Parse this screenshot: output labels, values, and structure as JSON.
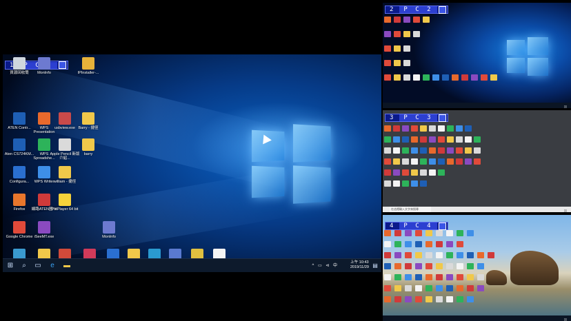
{
  "main": {
    "badge": {
      "number": "1",
      "label": "P C  1"
    },
    "icons": [
      {
        "label": "資源回收筒",
        "color": "#cfd6de"
      },
      {
        "label": "MonInfo",
        "color": "#6d7ad0"
      },
      {
        "label": "IPInstaller-...",
        "color": "#e6b23a"
      },
      {
        "label": "ATEN Contr...",
        "color": "#1e5fb5"
      },
      {
        "label": "WPS Presentation",
        "color": "#e8692c"
      },
      {
        "label": "usbview.exe",
        "color": "#c94a4a"
      },
      {
        "label": "Barry - 捷徑",
        "color": "#f0c84a"
      },
      {
        "label": "Aten CS724KM...",
        "color": "#1e5fb5"
      },
      {
        "label": "WPS Spreadshe...",
        "color": "#2db35a"
      },
      {
        "label": "Apple Pencil 新版介紹...",
        "color": "#dadada"
      },
      {
        "label": "barry",
        "color": "#f0c84a"
      },
      {
        "label": "Configura...",
        "color": "#2a6fd0"
      },
      {
        "label": "WPS Writer",
        "color": "#3e8fe8"
      },
      {
        "label": "william - 捷徑",
        "color": "#f0c84a"
      },
      {
        "label": "Firefox",
        "color": "#e8762c"
      },
      {
        "label": "線路ATEN圖 fit",
        "color": "#d03a3a"
      },
      {
        "label": "PotPlayer 64 bit",
        "color": "#f5d23a"
      },
      {
        "label": "Google Chrome",
        "color": "#e04a3a"
      },
      {
        "label": "iSeeMT.exe",
        "color": "#8a4ac0"
      },
      {
        "label": "MonInfo",
        "color": "#6d7ad0"
      },
      {
        "label": "Logitech Webca...",
        "color": "#3a9ad0"
      },
      {
        "label": "MouseRep...",
        "color": "#f0c84a"
      },
      {
        "label": "Sikuli IDE",
        "color": "#d04a3a"
      },
      {
        "label": "VaiLIS",
        "color": "#d03a5a"
      },
      {
        "label": "VS0801HA_...",
        "color": "#2a6fd0"
      },
      {
        "label": "IPvk",
        "color": "#f0c84a"
      },
      {
        "label": "MB Browser",
        "color": "#2a9ad0"
      },
      {
        "label": "putty_0.71...",
        "color": "#5a7ad0"
      },
      {
        "label": "Tera Term",
        "color": "#e0c040"
      },
      {
        "label": "新文字文件.txt",
        "color": "#f4f4f4"
      }
    ],
    "taskbar": {
      "start_icon": "windows-start-icon",
      "search_icon": "search-icon",
      "taskview_icon": "task-view-icon",
      "edge_icon": "edge-icon",
      "explorer_icon": "file-explorer-icon",
      "tray_text": "^ ▭ ⊲ 中",
      "time": "上午 10:43",
      "date": "2019/11/29"
    }
  },
  "pc2": {
    "badge": {
      "number": "2",
      "label": "P C  2"
    }
  },
  "pc3": {
    "badge": {
      "number": "3",
      "label": "P C  3"
    },
    "search_placeholder": "在這裡輸入文字來搜尋"
  },
  "pc4": {
    "badge": {
      "number": "4",
      "label": "P C  4"
    }
  },
  "colors": {
    "badge_bg": "#0a1a8a",
    "badge_label_bg": "#2c3fd0",
    "taskbar": "#0d1a2c"
  }
}
